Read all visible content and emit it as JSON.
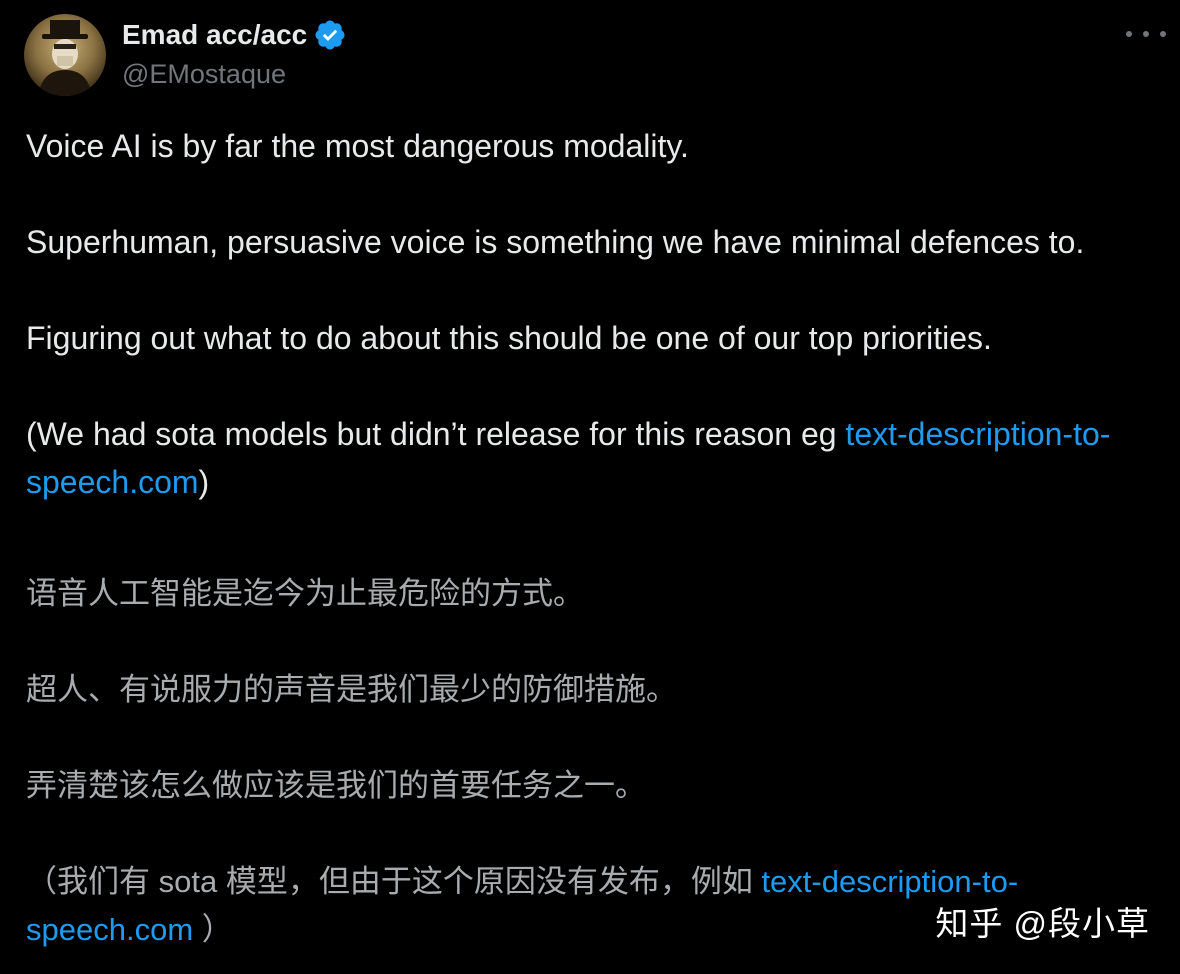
{
  "author": {
    "display_name": "Emad acc/acc",
    "handle": "@EMostaque",
    "verified": true,
    "avatar_icon": "avatar-masked-figure"
  },
  "menu": {
    "icon": "more-horizontal-icon"
  },
  "tweet": {
    "p1": "Voice AI is by far the most dangerous modality.",
    "p2": "Superhuman, persuasive voice is something we have minimal defences to.",
    "p3": "Figuring out what to do about this should be one of our top priorities.",
    "p4_prefix": "(We had sota models but didn’t release for this reason eg ",
    "p4_link": "text-description-to-speech.com",
    "p4_suffix": ")"
  },
  "translation": {
    "p1": "语音人工智能是迄今为止最危险的方式。",
    "p2": "超人、有说服力的声音是我们最少的防御措施。",
    "p3": "弄清楚该怎么做应该是我们的首要任务之一。",
    "p4_prefix": "（我们有 sota 模型，但由于这个原因没有发布，例如 ",
    "p4_link": "text-description-to-speech.com",
    "p4_suffix": " ）"
  },
  "watermark": {
    "text": "知乎 @段小草"
  },
  "colors": {
    "background": "#000000",
    "text": "#e7e9ea",
    "secondary": "#71767b",
    "link": "#1d9bf0",
    "verified": "#1d9bf0"
  }
}
